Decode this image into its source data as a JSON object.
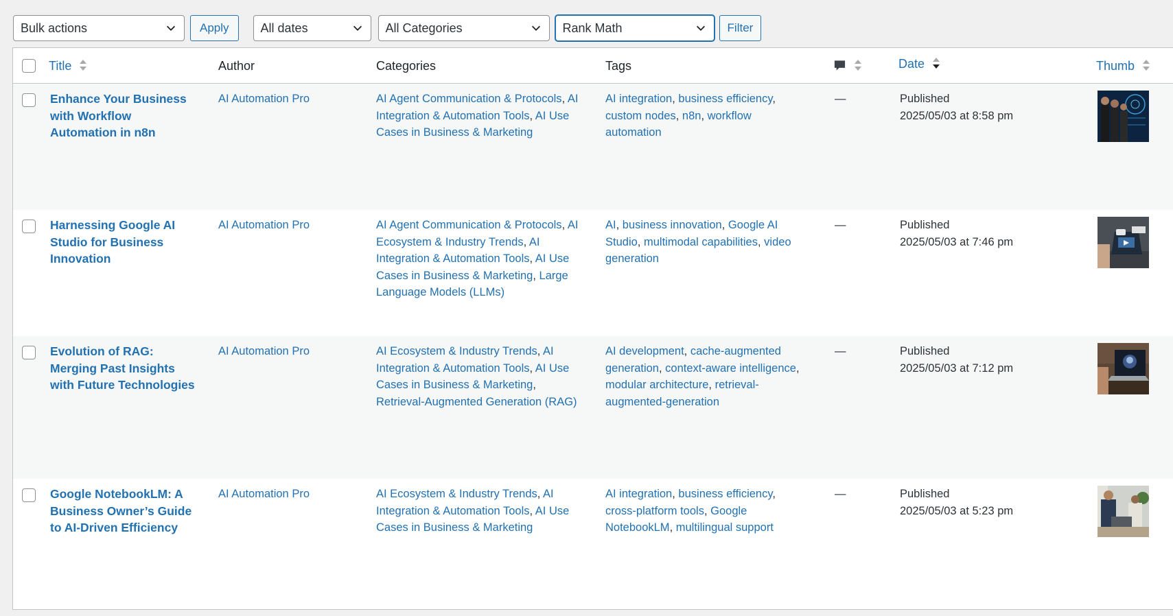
{
  "toolbar": {
    "bulk_actions": "Bulk actions",
    "apply": "Apply",
    "all_dates": "All dates",
    "all_categories": "All Categories",
    "seo_filter": "Rank Math",
    "filter": "Filter"
  },
  "columns": {
    "title": "Title",
    "author": "Author",
    "categories": "Categories",
    "tags": "Tags",
    "comments_icon": "comment-bubble-icon",
    "date": "Date",
    "thumb": "Thumb"
  },
  "posts": [
    {
      "title_lines": [
        "Enhance Your Business",
        "with Workflow",
        "Automation in n8n"
      ],
      "author": "AI Automation Pro",
      "categories_lines": [
        [
          [
            "AI Agent Communication & Protocols",
            ","
          ],
          [
            "AI",
            ""
          ]
        ],
        [
          [
            "Integration & Automation Tools",
            ","
          ],
          [
            "AI Use",
            ""
          ]
        ],
        [
          [
            "Cases in Business & Marketing",
            ""
          ]
        ]
      ],
      "tags_lines": [
        [
          [
            "AI integration",
            ","
          ],
          [
            "business efficiency",
            ","
          ]
        ],
        [
          [
            "custom nodes",
            ","
          ],
          [
            "n8n",
            ","
          ],
          [
            "workflow",
            ""
          ]
        ],
        [
          [
            "automation",
            ""
          ]
        ]
      ],
      "comments": "—",
      "status": "Published",
      "date": "2025/05/03 at 8:58 pm",
      "thumb": "business-team-ai-icon"
    },
    {
      "title_lines": [
        "Harnessing Google AI",
        "Studio for Business",
        "Innovation"
      ],
      "author": "AI Automation Pro",
      "categories_lines": [
        [
          [
            "AI Agent Communication & Protocols",
            ","
          ],
          [
            "AI",
            ""
          ]
        ],
        [
          [
            "Ecosystem & Industry Trends",
            ","
          ],
          [
            "AI",
            ""
          ]
        ],
        [
          [
            "Integration & Automation Tools",
            ","
          ],
          [
            "AI Use",
            ""
          ]
        ],
        [
          [
            "Cases in Business & Marketing",
            ","
          ],
          [
            "Large",
            ""
          ]
        ],
        [
          [
            "Language Models (LLMs)",
            ""
          ]
        ]
      ],
      "tags_lines": [
        [
          [
            "AI",
            ","
          ],
          [
            "business innovation",
            ","
          ],
          [
            "Google AI",
            ""
          ]
        ],
        [
          [
            "Studio",
            ","
          ],
          [
            "multimodal capabilities",
            ","
          ],
          [
            "video",
            ""
          ]
        ],
        [
          [
            "generation",
            ""
          ]
        ]
      ],
      "comments": "—",
      "status": "Published",
      "date": "2025/05/03 at 7:46 pm",
      "thumb": "laptop-ai-studio-icon"
    },
    {
      "title_lines": [
        "Evolution of RAG:",
        "Merging Past Insights",
        "with Future Technologies"
      ],
      "author": "AI Automation Pro",
      "categories_lines": [
        [
          [
            "AI Ecosystem & Industry Trends",
            ","
          ],
          [
            "AI",
            ""
          ]
        ],
        [
          [
            "Integration & Automation Tools",
            ","
          ],
          [
            "AI Use",
            ""
          ]
        ],
        [
          [
            "Cases in Business & Marketing",
            ","
          ]
        ],
        [
          [
            "Retrieval-Augmented Generation (RAG)",
            ""
          ]
        ]
      ],
      "tags_lines": [
        [
          [
            "AI development",
            ","
          ],
          [
            "cache-augmented",
            ""
          ]
        ],
        [
          [
            "generation",
            ","
          ],
          [
            "context-aware intelligence",
            ","
          ]
        ],
        [
          [
            "modular architecture",
            ","
          ],
          [
            "retrieval-",
            ""
          ]
        ],
        [
          [
            "augmented-generation",
            ""
          ]
        ]
      ],
      "comments": "—",
      "status": "Published",
      "date": "2025/05/03 at 7:12 pm",
      "thumb": "laptop-ai-face-icon"
    },
    {
      "title_lines": [
        "Google NotebookLM: A",
        "Business Owner’s Guide",
        "to AI-Driven Efficiency"
      ],
      "author": "AI Automation Pro",
      "categories_lines": [
        [
          [
            "AI Ecosystem & Industry Trends",
            ","
          ],
          [
            "AI",
            ""
          ]
        ],
        [
          [
            "Integration & Automation Tools",
            ","
          ],
          [
            "AI Use",
            ""
          ]
        ],
        [
          [
            "Cases in Business & Marketing",
            ""
          ]
        ]
      ],
      "tags_lines": [
        [
          [
            "AI integration",
            ","
          ],
          [
            "business efficiency",
            ","
          ]
        ],
        [
          [
            "cross-platform tools",
            ","
          ],
          [
            "Google",
            ""
          ]
        ],
        [
          [
            "NotebookLM",
            ","
          ],
          [
            "multilingual support",
            ""
          ]
        ]
      ],
      "comments": "—",
      "status": "Published",
      "date": "2025/05/03 at 5:23 pm",
      "thumb": "office-team-laptops-icon"
    }
  ]
}
